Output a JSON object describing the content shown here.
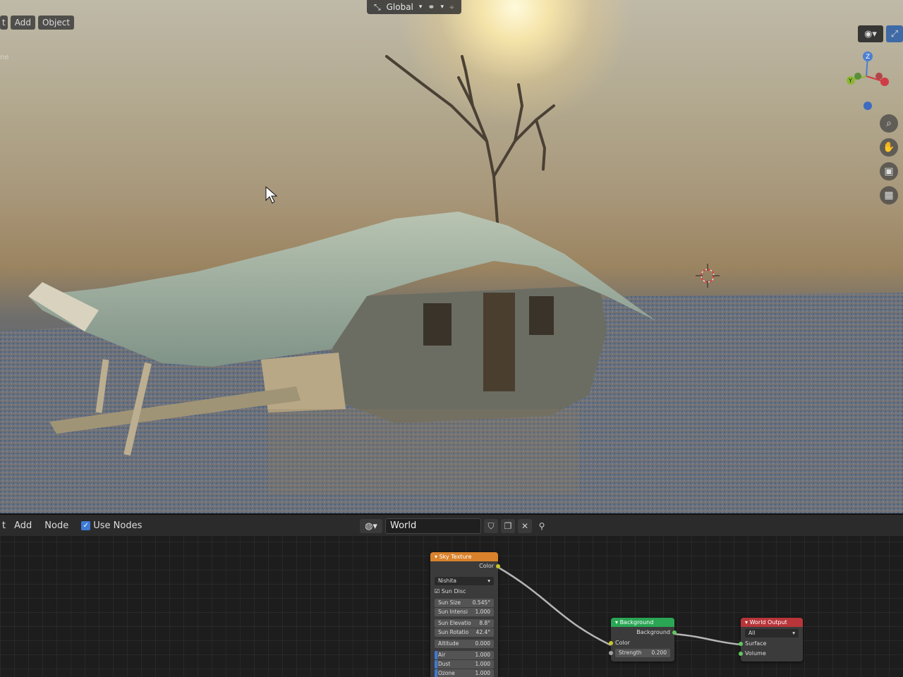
{
  "viewport": {
    "header_menu": [
      "t",
      "Add",
      "Object"
    ],
    "top_bar": {
      "transform_orientation": "Global"
    },
    "side_label": "ne"
  },
  "node_editor": {
    "menu": [
      "t",
      "Add",
      "Node"
    ],
    "use_nodes_label": "Use Nodes",
    "use_nodes_checked": true,
    "world_name": "World"
  },
  "nodes": {
    "sky_texture": {
      "title": "Sky Texture",
      "output": "Color",
      "sky_type": "Nishita",
      "sun_disc_label": "Sun Disc",
      "fields": [
        {
          "label": "Sun Size",
          "value": "0.545°"
        },
        {
          "label": "Sun Intensi",
          "value": "1.000"
        },
        {
          "label": "Sun Elevatio",
          "value": "8.8°"
        },
        {
          "label": "Sun Rotatio",
          "value": "42.4°"
        },
        {
          "label": "Altitude",
          "value": "0.000"
        },
        {
          "label": "Air",
          "value": "1.000"
        },
        {
          "label": "Dust",
          "value": "1.000"
        },
        {
          "label": "Ozone",
          "value": "1.000"
        }
      ]
    },
    "background": {
      "title": "Background",
      "output": "Background",
      "input_color": "Color",
      "strength_label": "Strength",
      "strength_value": "0.200"
    },
    "world_output": {
      "title": "World Output",
      "target": "All",
      "inputs": [
        "Surface",
        "Volume"
      ]
    }
  },
  "colors": {
    "texture_header": "#d9822b",
    "shader_header": "#2aa655",
    "output_header": "#b8353a",
    "selection_accent": "#3e7ad6"
  }
}
